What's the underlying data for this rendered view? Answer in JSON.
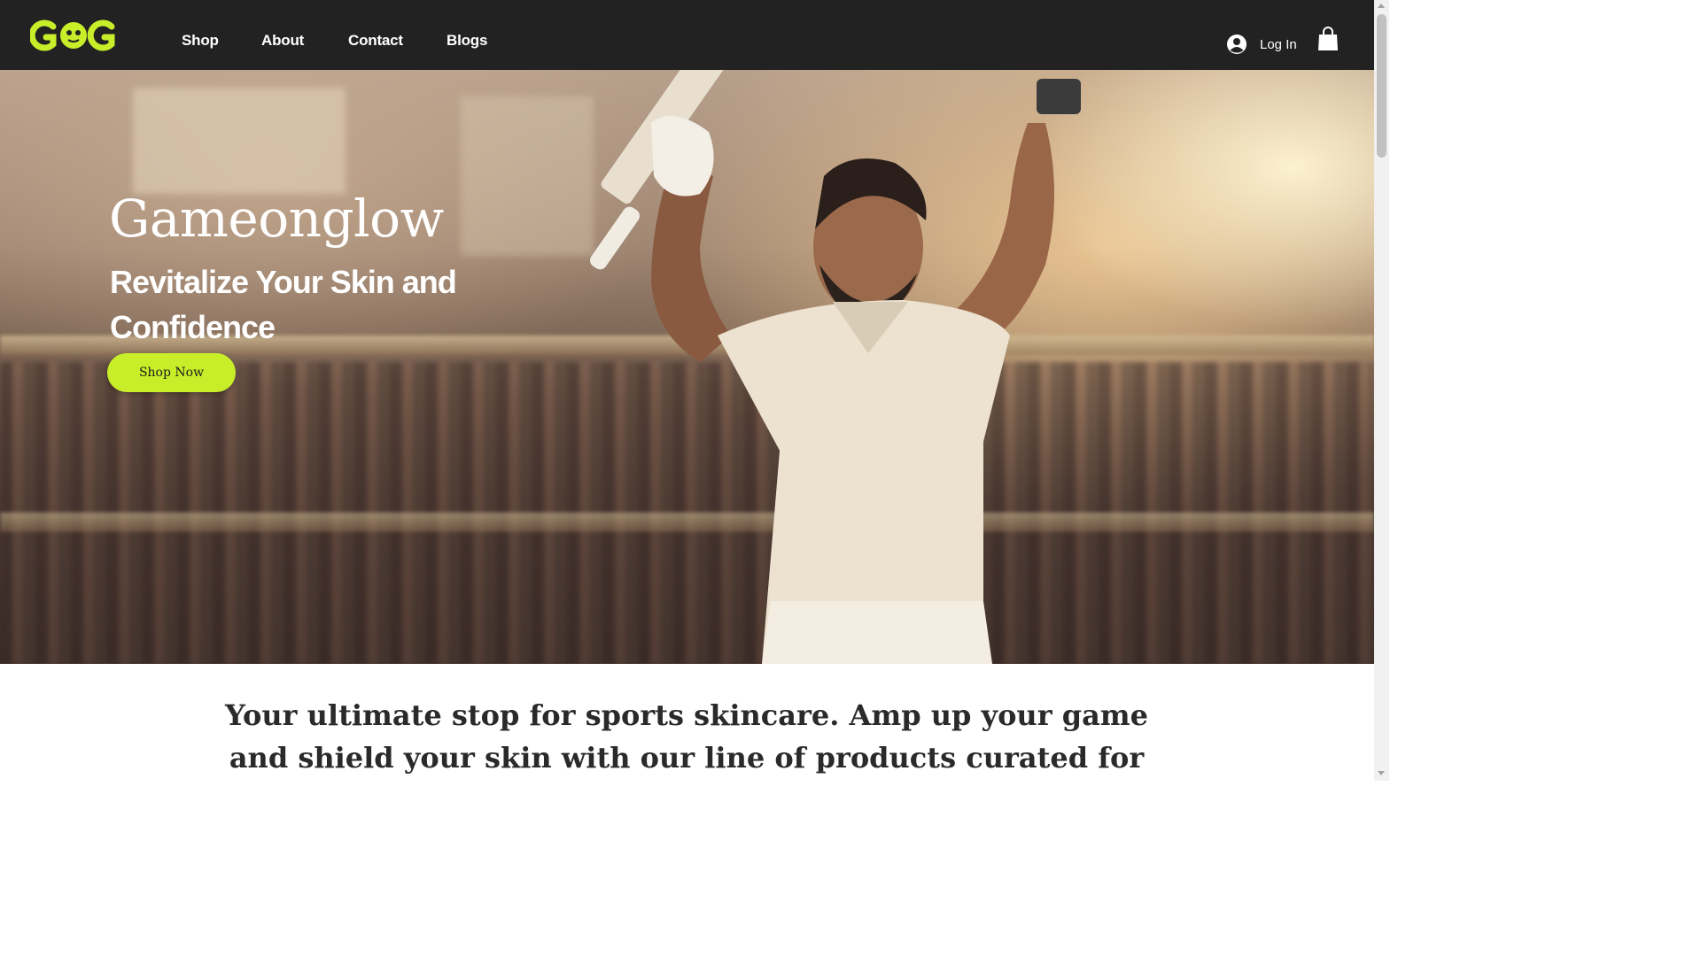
{
  "brand": {
    "logo_text": "GOG",
    "accent_color": "#c8ee2a",
    "header_color": "#222222"
  },
  "nav": {
    "items": [
      {
        "label": "Shop"
      },
      {
        "label": "About"
      },
      {
        "label": "Contact"
      },
      {
        "label": "Blogs"
      }
    ]
  },
  "account": {
    "login_label": "Log In",
    "login_icon": "user-circle-icon",
    "cart_icon": "shopping-bag-icon"
  },
  "hero": {
    "title": "Gameonglow",
    "subtitle": "Revitalize Your Skin and Confidence",
    "cta_label": "Shop Now",
    "image_subject": "cricket-player-celebrating-icon"
  },
  "intro": {
    "text": "Your ultimate stop for sports skincare. Amp up your game and shield your skin with our line of products curated for athletes, cricketers, and fitness aficionados."
  }
}
